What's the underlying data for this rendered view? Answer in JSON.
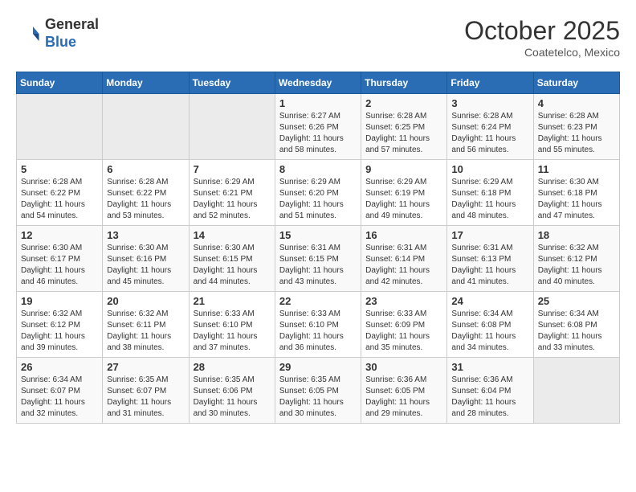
{
  "header": {
    "logo_line1": "General",
    "logo_line2": "Blue",
    "month": "October 2025",
    "location": "Coatetelco, Mexico"
  },
  "weekdays": [
    "Sunday",
    "Monday",
    "Tuesday",
    "Wednesday",
    "Thursday",
    "Friday",
    "Saturday"
  ],
  "weeks": [
    [
      {
        "day": "",
        "info": ""
      },
      {
        "day": "",
        "info": ""
      },
      {
        "day": "",
        "info": ""
      },
      {
        "day": "1",
        "info": "Sunrise: 6:27 AM\nSunset: 6:26 PM\nDaylight: 11 hours and 58 minutes."
      },
      {
        "day": "2",
        "info": "Sunrise: 6:28 AM\nSunset: 6:25 PM\nDaylight: 11 hours and 57 minutes."
      },
      {
        "day": "3",
        "info": "Sunrise: 6:28 AM\nSunset: 6:24 PM\nDaylight: 11 hours and 56 minutes."
      },
      {
        "day": "4",
        "info": "Sunrise: 6:28 AM\nSunset: 6:23 PM\nDaylight: 11 hours and 55 minutes."
      }
    ],
    [
      {
        "day": "5",
        "info": "Sunrise: 6:28 AM\nSunset: 6:22 PM\nDaylight: 11 hours and 54 minutes."
      },
      {
        "day": "6",
        "info": "Sunrise: 6:28 AM\nSunset: 6:22 PM\nDaylight: 11 hours and 53 minutes."
      },
      {
        "day": "7",
        "info": "Sunrise: 6:29 AM\nSunset: 6:21 PM\nDaylight: 11 hours and 52 minutes."
      },
      {
        "day": "8",
        "info": "Sunrise: 6:29 AM\nSunset: 6:20 PM\nDaylight: 11 hours and 51 minutes."
      },
      {
        "day": "9",
        "info": "Sunrise: 6:29 AM\nSunset: 6:19 PM\nDaylight: 11 hours and 49 minutes."
      },
      {
        "day": "10",
        "info": "Sunrise: 6:29 AM\nSunset: 6:18 PM\nDaylight: 11 hours and 48 minutes."
      },
      {
        "day": "11",
        "info": "Sunrise: 6:30 AM\nSunset: 6:18 PM\nDaylight: 11 hours and 47 minutes."
      }
    ],
    [
      {
        "day": "12",
        "info": "Sunrise: 6:30 AM\nSunset: 6:17 PM\nDaylight: 11 hours and 46 minutes."
      },
      {
        "day": "13",
        "info": "Sunrise: 6:30 AM\nSunset: 6:16 PM\nDaylight: 11 hours and 45 minutes."
      },
      {
        "day": "14",
        "info": "Sunrise: 6:30 AM\nSunset: 6:15 PM\nDaylight: 11 hours and 44 minutes."
      },
      {
        "day": "15",
        "info": "Sunrise: 6:31 AM\nSunset: 6:15 PM\nDaylight: 11 hours and 43 minutes."
      },
      {
        "day": "16",
        "info": "Sunrise: 6:31 AM\nSunset: 6:14 PM\nDaylight: 11 hours and 42 minutes."
      },
      {
        "day": "17",
        "info": "Sunrise: 6:31 AM\nSunset: 6:13 PM\nDaylight: 11 hours and 41 minutes."
      },
      {
        "day": "18",
        "info": "Sunrise: 6:32 AM\nSunset: 6:12 PM\nDaylight: 11 hours and 40 minutes."
      }
    ],
    [
      {
        "day": "19",
        "info": "Sunrise: 6:32 AM\nSunset: 6:12 PM\nDaylight: 11 hours and 39 minutes."
      },
      {
        "day": "20",
        "info": "Sunrise: 6:32 AM\nSunset: 6:11 PM\nDaylight: 11 hours and 38 minutes."
      },
      {
        "day": "21",
        "info": "Sunrise: 6:33 AM\nSunset: 6:10 PM\nDaylight: 11 hours and 37 minutes."
      },
      {
        "day": "22",
        "info": "Sunrise: 6:33 AM\nSunset: 6:10 PM\nDaylight: 11 hours and 36 minutes."
      },
      {
        "day": "23",
        "info": "Sunrise: 6:33 AM\nSunset: 6:09 PM\nDaylight: 11 hours and 35 minutes."
      },
      {
        "day": "24",
        "info": "Sunrise: 6:34 AM\nSunset: 6:08 PM\nDaylight: 11 hours and 34 minutes."
      },
      {
        "day": "25",
        "info": "Sunrise: 6:34 AM\nSunset: 6:08 PM\nDaylight: 11 hours and 33 minutes."
      }
    ],
    [
      {
        "day": "26",
        "info": "Sunrise: 6:34 AM\nSunset: 6:07 PM\nDaylight: 11 hours and 32 minutes."
      },
      {
        "day": "27",
        "info": "Sunrise: 6:35 AM\nSunset: 6:07 PM\nDaylight: 11 hours and 31 minutes."
      },
      {
        "day": "28",
        "info": "Sunrise: 6:35 AM\nSunset: 6:06 PM\nDaylight: 11 hours and 30 minutes."
      },
      {
        "day": "29",
        "info": "Sunrise: 6:35 AM\nSunset: 6:05 PM\nDaylight: 11 hours and 30 minutes."
      },
      {
        "day": "30",
        "info": "Sunrise: 6:36 AM\nSunset: 6:05 PM\nDaylight: 11 hours and 29 minutes."
      },
      {
        "day": "31",
        "info": "Sunrise: 6:36 AM\nSunset: 6:04 PM\nDaylight: 11 hours and 28 minutes."
      },
      {
        "day": "",
        "info": ""
      }
    ]
  ]
}
